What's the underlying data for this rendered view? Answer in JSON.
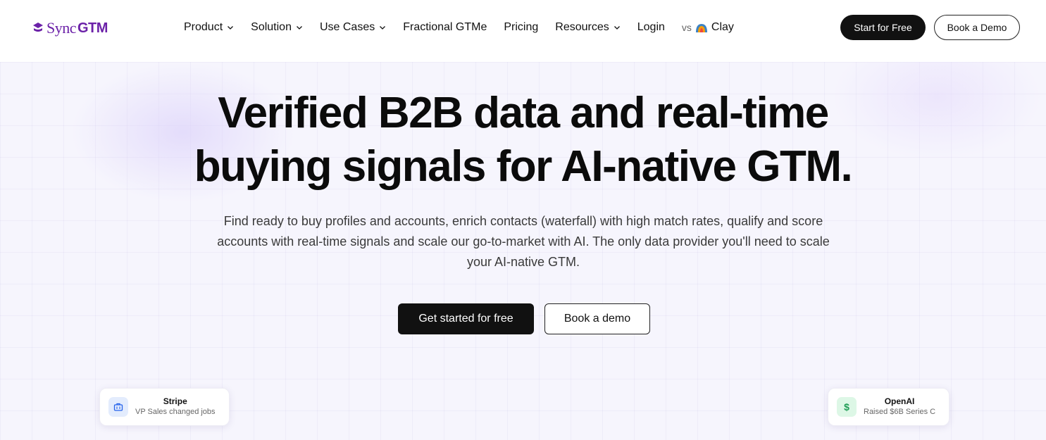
{
  "brand": {
    "logo_sync": "Sync",
    "logo_gtm": "GTM",
    "color": "#6b21a8"
  },
  "nav": {
    "items": [
      {
        "label": "Product",
        "dropdown": true
      },
      {
        "label": "Solution",
        "dropdown": true
      },
      {
        "label": "Use Cases",
        "dropdown": true
      },
      {
        "label": "Fractional GTMe",
        "dropdown": false
      },
      {
        "label": "Pricing",
        "dropdown": false
      },
      {
        "label": "Resources",
        "dropdown": true
      },
      {
        "label": "Login",
        "dropdown": false
      }
    ],
    "vs_prefix": "vs",
    "vs_label": "Clay",
    "start_free": "Start for Free",
    "book_demo": "Book a Demo"
  },
  "hero": {
    "headline_line1": "Verified B2B data and real-time",
    "headline_line2": "buying signals for AI-native GTM.",
    "subtext": "Find ready to buy profiles and accounts, enrich contacts (waterfall) with high match rates, qualify and score accounts with real-time signals and scale our go-to-market with AI. The only data provider you'll need to scale your AI-native GTM.",
    "cta_primary": "Get started for free",
    "cta_secondary": "Book a demo"
  },
  "cards": [
    {
      "title": "Stripe",
      "subtitle": "VP Sales changed jobs",
      "icon": "briefcase-icon"
    },
    {
      "title": "OpenAI",
      "subtitle": "Raised $6B Series C",
      "icon": "dollar-icon",
      "glyph": "$"
    }
  ]
}
